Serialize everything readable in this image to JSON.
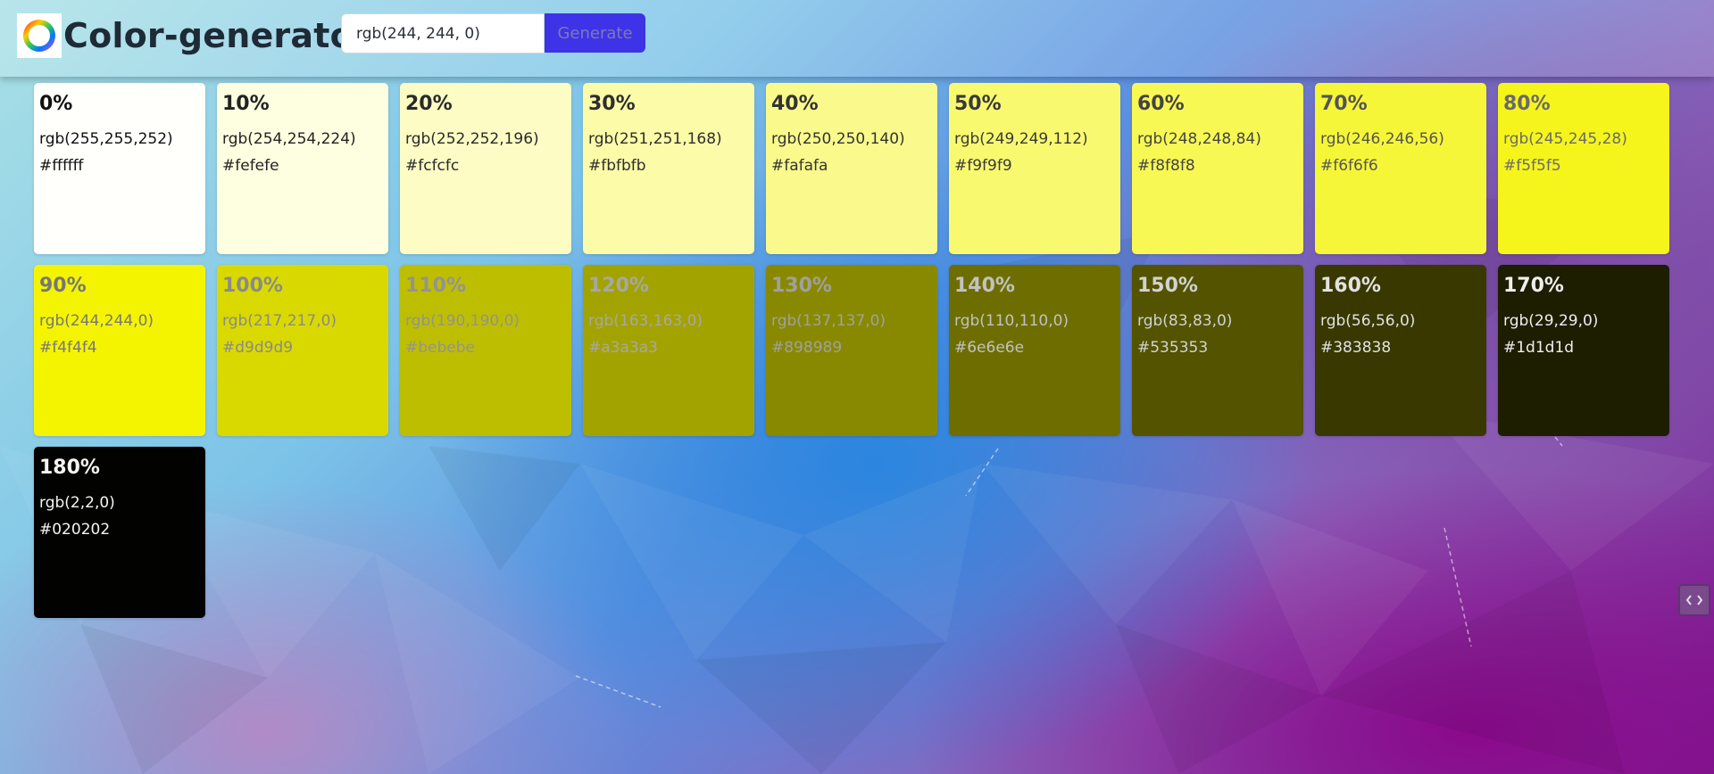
{
  "header": {
    "brand_name": "Color-generator",
    "input_value": "rgb(244, 244, 0)",
    "generate_label": "Generate",
    "logo_icon": "color-wheel-icon"
  },
  "floating_button": {
    "icon": "code-brackets-icon"
  },
  "swatches": [
    {
      "pct": "0%",
      "rgb": "rgb(255,255,252)",
      "hex": "#ffffff",
      "bg": "#fffffc",
      "fg": "#111111"
    },
    {
      "pct": "10%",
      "rgb": "rgb(254,254,224)",
      "hex": "#fefefe",
      "bg": "#fefee0",
      "fg": "#222222"
    },
    {
      "pct": "20%",
      "rgb": "rgb(252,252,196)",
      "hex": "#fcfcfc",
      "bg": "#fcfcc4",
      "fg": "#2a2a2a"
    },
    {
      "pct": "30%",
      "rgb": "rgb(251,251,168)",
      "hex": "#fbfbfb",
      "bg": "#fbfba8",
      "fg": "#2e2e2e"
    },
    {
      "pct": "40%",
      "rgb": "rgb(250,250,140)",
      "hex": "#fafafa",
      "bg": "#fafa8c",
      "fg": "#333333"
    },
    {
      "pct": "50%",
      "rgb": "rgb(249,249,112)",
      "hex": "#f9f9f9",
      "bg": "#f9f970",
      "fg": "#3a3a3a"
    },
    {
      "pct": "60%",
      "rgb": "rgb(248,248,84)",
      "hex": "#f8f8f8",
      "bg": "#f8f854",
      "fg": "#444444"
    },
    {
      "pct": "70%",
      "rgb": "rgb(246,246,56)",
      "hex": "#f6f6f6",
      "bg": "#f6f638",
      "fg": "#555555"
    },
    {
      "pct": "80%",
      "rgb": "rgb(245,245,28)",
      "hex": "#f5f5f5",
      "bg": "#f5f51c",
      "fg": "#6a6a6a"
    },
    {
      "pct": "90%",
      "rgb": "rgb(244,244,0)",
      "hex": "#f4f4f4",
      "bg": "#f4f400",
      "fg": "#777777"
    },
    {
      "pct": "100%",
      "rgb": "rgb(217,217,0)",
      "hex": "#d9d9d9",
      "bg": "#d9d900",
      "fg": "#8a8a8a"
    },
    {
      "pct": "110%",
      "rgb": "rgb(190,190,0)",
      "hex": "#bebebe",
      "bg": "#bebe00",
      "fg": "#939393"
    },
    {
      "pct": "120%",
      "rgb": "rgb(163,163,0)",
      "hex": "#a3a3a3",
      "bg": "#a3a300",
      "fg": "#a7a7a7"
    },
    {
      "pct": "130%",
      "rgb": "rgb(137,137,0)",
      "hex": "#898989",
      "bg": "#898900",
      "fg": "#a0a0a0"
    },
    {
      "pct": "140%",
      "rgb": "rgb(110,110,0)",
      "hex": "#6e6e6e",
      "bg": "#6e6e00",
      "fg": "#c2c2c2"
    },
    {
      "pct": "150%",
      "rgb": "rgb(83,83,0)",
      "hex": "#535353",
      "bg": "#535300",
      "fg": "#d2d2d2"
    },
    {
      "pct": "160%",
      "rgb": "rgb(56,56,0)",
      "hex": "#383838",
      "bg": "#383800",
      "fg": "#e2e2e2"
    },
    {
      "pct": "170%",
      "rgb": "rgb(29,29,0)",
      "hex": "#1d1d1d",
      "bg": "#1d1d00",
      "fg": "#eeeeee"
    },
    {
      "pct": "180%",
      "rgb": "rgb(2,2,0)",
      "hex": "#020202",
      "bg": "#020200",
      "fg": "#f4f4f4"
    }
  ]
}
